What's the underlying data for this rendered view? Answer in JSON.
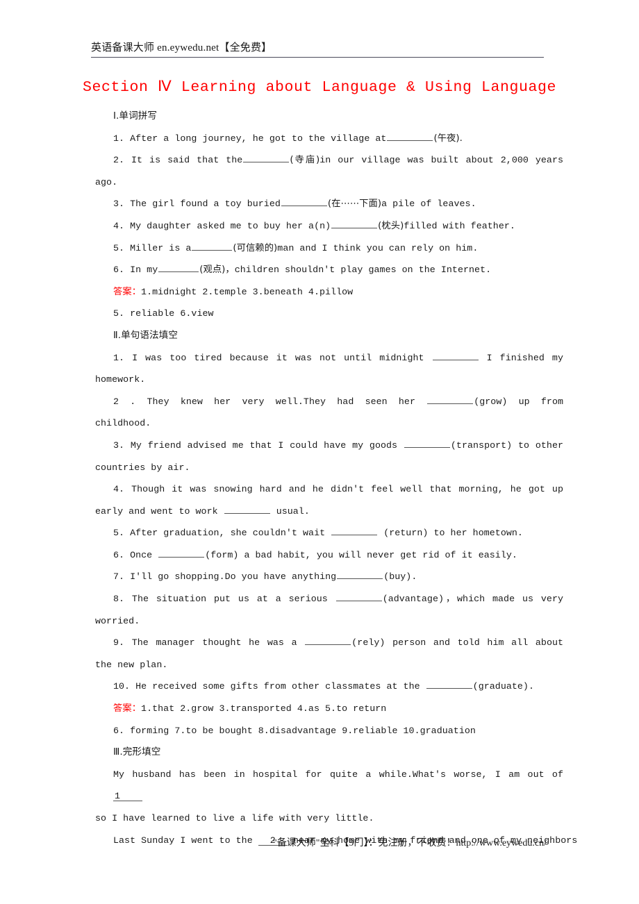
{
  "header": {
    "text": "英语备课大师  en.eywedu.net【全免费】"
  },
  "title": "Section Ⅳ  Learning about Language & Using Language",
  "colors": {
    "accent_red": "#ff0000",
    "body_text": "#1a1a1a",
    "rule": "#4a4a5a"
  },
  "sections": [
    {
      "heading": "Ⅰ.单词拼写",
      "items": [
        {
          "num": "1.",
          "pre": "After a long journey, he got to the village at",
          "hint": "(午夜).",
          "post": ""
        },
        {
          "num": "2.",
          "pre": "It is said that the",
          "hint": "(寺庙)",
          "post": "in our village was built about 2,000 years",
          "cont": "ago."
        },
        {
          "num": "3.",
          "pre": "The girl found a toy buried",
          "hint": "(在⋯⋯下面)",
          "post": "a pile of leaves."
        },
        {
          "num": "4.",
          "pre": "My daughter asked me to buy her a(n)",
          "hint": "(枕头)",
          "post": "filled with feather."
        },
        {
          "num": "5.",
          "pre": "Miller is a",
          "hint": "(可信赖的)",
          "post": "man and I think you can rely on him."
        },
        {
          "num": "6.",
          "pre": "In my",
          "hint": "(观点)",
          "post": "，children shouldn't play games on the Internet."
        }
      ],
      "answer_label": "答案：",
      "answer_line_1": "1.midnight  2.temple  3.beneath  4.pillow",
      "answer_line_2": "5. reliable  6.view"
    },
    {
      "heading": "Ⅱ.单句语法填空",
      "items": [
        {
          "num": "1.",
          "pre": "I was too tired because it was not until midnight",
          "post": "I finished my",
          "cont": "homework."
        },
        {
          "num": "2 .",
          "pre": "They  knew  her  very  well.They  had  seen  her",
          "hint": "(grow)",
          "post": "up  from",
          "cont": "childhood."
        },
        {
          "num": "3.",
          "pre": "My friend advised me that I could have my goods",
          "hint": "(transport)",
          "post": "to other",
          "cont": "countries by air."
        },
        {
          "num": "4.",
          "pre": "Though it was snowing hard and he didn't feel well that morning, he got up",
          "cont_pre": "early and went to work",
          "cont_post": "usual."
        },
        {
          "num": "5.",
          "pre": "After graduation, she couldn't wait",
          "hint": "(return)",
          "post": "to her hometown."
        },
        {
          "num": "6.",
          "pre": "Once",
          "hint": "(form)",
          "post": "a bad habit, you will never get rid of it easily."
        },
        {
          "num": "7.",
          "pre": "I'll go shopping.Do you have anything",
          "hint": "(buy).",
          "post": ""
        },
        {
          "num": "8.",
          "pre": "The situation put us at a serious",
          "hint": "(advantage)",
          "post": "，which made us very",
          "cont": "worried."
        },
        {
          "num": "9.",
          "pre": "The manager thought he was a",
          "hint": "(rely)",
          "post": "person and told him all about",
          "cont": "the new plan."
        },
        {
          "num": "10.",
          "pre": "He received some gifts from other classmates at the",
          "hint": "(graduate).",
          "post": ""
        }
      ],
      "answer_label": "答案：",
      "answer_line_1": "1.that  2.grow  3.transported  4.as  5.to return",
      "answer_line_2": "6. forming  7.to be bought  8.disadvantage  9.reliable  10.graduation"
    },
    {
      "heading": "Ⅲ.完形填空",
      "paragraphs": [
        {
          "line1_pre": "My husband has been in hospital for quite a while.What's worse, I am out of",
          "blank_num": "1",
          "line2": "so I have learned to live a life with very little."
        },
        {
          "line1_pre": "Last Sunday I went to the",
          "blank_num": "2",
          "line1_post": "near my home with my friend and one of my neighbors"
        }
      ]
    }
  ],
  "footer": {
    "text": "\"备课大师\"全科【9门】：免注册，不收费！http://www.eywedu.cn/"
  }
}
